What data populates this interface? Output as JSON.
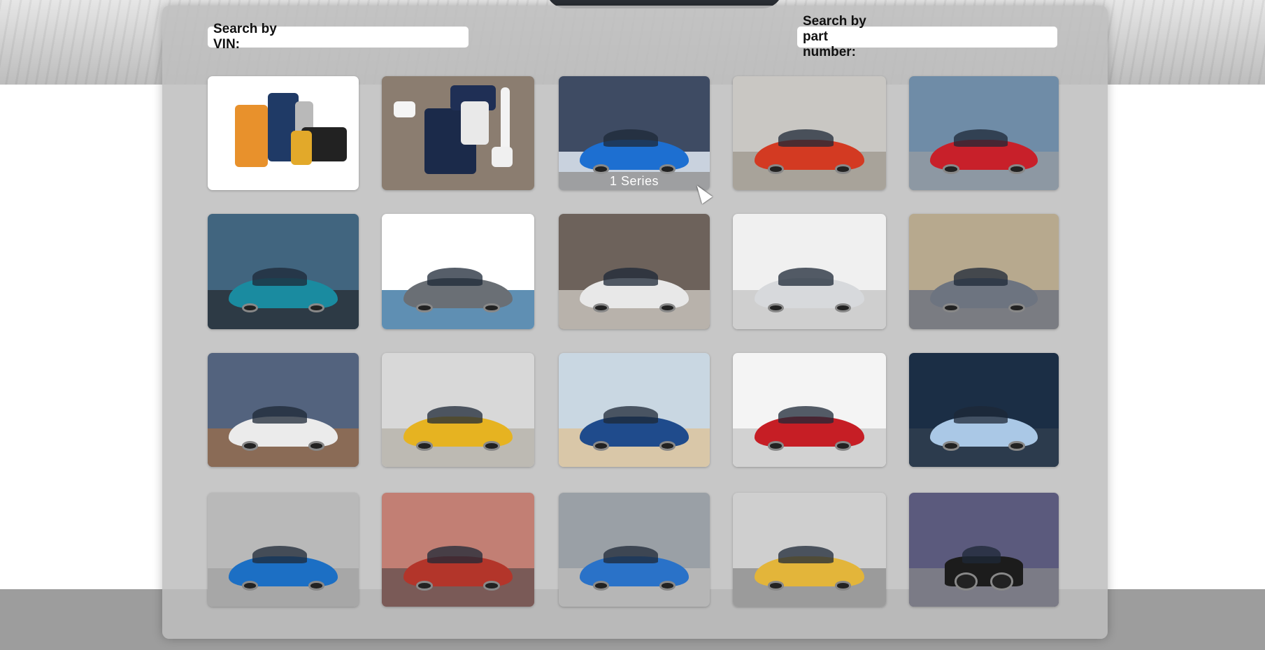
{
  "search": {
    "vin_label": "Search by VIN:",
    "part_label": "Search by part number:"
  },
  "tiles": [
    {
      "name": "tile-parts-service-kit",
      "kind": "accessory",
      "bg": "#ffffff",
      "accent": "#1f3a66"
    },
    {
      "name": "tile-lifestyle-merchandise",
      "kind": "merch",
      "bg": "#8b7d70",
      "accent": "#1b2a4a"
    },
    {
      "name": "tile-1-series",
      "kind": "car",
      "caption": "1 Series",
      "bg": "#3e4b63",
      "ground": "#c9d2de",
      "car": "#1d6fd1"
    },
    {
      "name": "tile-2-series",
      "kind": "car",
      "bg": "#c9c7c3",
      "ground": "#a8a39a",
      "car": "#d33a22"
    },
    {
      "name": "tile-3-series",
      "kind": "car",
      "bg": "#6f8ca7",
      "ground": "#8d98a3",
      "car": "#c8202a"
    },
    {
      "name": "tile-4-series",
      "kind": "car",
      "bg": "#41657f",
      "ground": "#2d3a45",
      "car": "#1a8ba0"
    },
    {
      "name": "tile-5-series",
      "kind": "car",
      "bg": "#ffffff",
      "ground": "#5f8fb3",
      "car": "#6a6f75"
    },
    {
      "name": "tile-6-series",
      "kind": "car",
      "bg": "#6d625b",
      "ground": "#b8b2ab",
      "car": "#e8e8e8"
    },
    {
      "name": "tile-7-series",
      "kind": "car",
      "bg": "#f0f0f0",
      "ground": "#cfcfcf",
      "car": "#d7d9dc"
    },
    {
      "name": "tile-8-series",
      "kind": "car",
      "bg": "#b7a98e",
      "ground": "#7a7c82",
      "car": "#6d7480"
    },
    {
      "name": "tile-x1",
      "kind": "car",
      "bg": "#53637e",
      "ground": "#8a6b56",
      "car": "#ebebeb"
    },
    {
      "name": "tile-x2",
      "kind": "car",
      "bg": "#d8d8d8",
      "ground": "#bdbab3",
      "car": "#e6b321"
    },
    {
      "name": "tile-x3",
      "kind": "car",
      "bg": "#c9d7e2",
      "ground": "#d9c7a8",
      "car": "#1f4b8c"
    },
    {
      "name": "tile-x4",
      "kind": "car",
      "bg": "#f4f4f4",
      "ground": "#d2d2d2",
      "car": "#c61e25"
    },
    {
      "name": "tile-x5",
      "kind": "car",
      "bg": "#1b2e45",
      "ground": "#2c3b4d",
      "car": "#aac8e6"
    },
    {
      "name": "tile-x6",
      "kind": "car",
      "bg": "#b9b9b9",
      "ground": "#a7a7a7",
      "car": "#1c6fc4"
    },
    {
      "name": "tile-z4",
      "kind": "car",
      "bg": "#c27f74",
      "ground": "#7a5a57",
      "car": "#b3352a"
    },
    {
      "name": "tile-i8",
      "kind": "car",
      "bg": "#9aa0a6",
      "ground": "#b6b6b6",
      "car": "#2a72c8"
    },
    {
      "name": "tile-mini",
      "kind": "car",
      "bg": "#cfcfcf",
      "ground": "#9b9b9b",
      "car": "#e3b53a"
    },
    {
      "name": "tile-motorrad",
      "kind": "bike",
      "bg": "#5b5a7d",
      "ground": "#7b7b86",
      "car": "#1c1c1c"
    }
  ]
}
